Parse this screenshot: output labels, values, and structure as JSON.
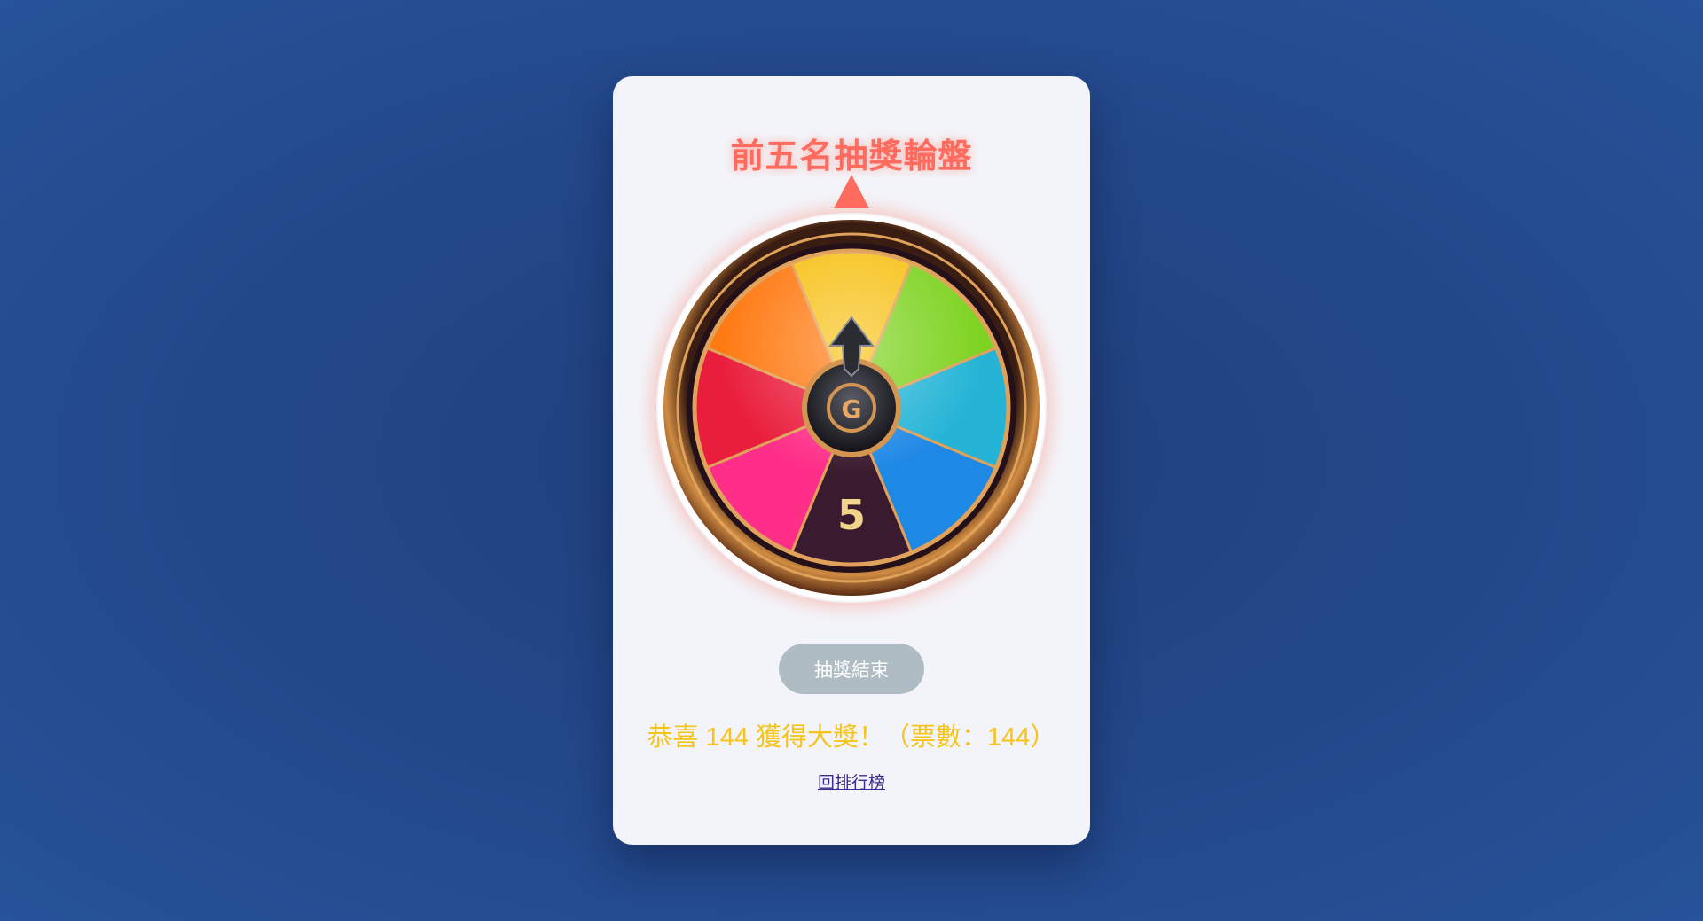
{
  "page": {
    "title": "前五名抽獎輪盤"
  },
  "wheel": {
    "center_number": "5",
    "center_emblem": "G",
    "segment_colors": [
      "#f7c21a",
      "#7ed321",
      "#25b4d6",
      "#1e88e5",
      "#3a1a2e",
      "#ff2e88",
      "#e91e3c",
      "#ff7a12"
    ],
    "pointer_color": "#ff6b5f",
    "rim_color": "#c8843c"
  },
  "controls": {
    "spin_button_label": "抽獎結束",
    "spin_button_disabled": true
  },
  "result": {
    "message": "恭喜 144 獲得大獎！（票數：144）"
  },
  "nav": {
    "back_link_label": "回排行榜"
  },
  "icons": {
    "wheel_arrow": "up-arrow-icon",
    "title_pointer": "triangle-pointer-icon"
  }
}
